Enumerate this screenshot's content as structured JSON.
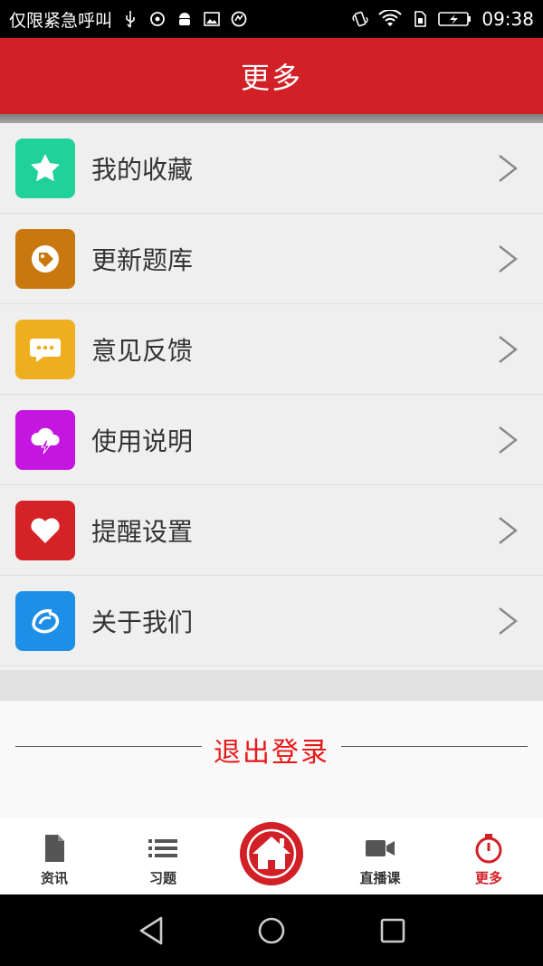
{
  "status_bar": {
    "carrier": "仅限紧急呼叫",
    "time": "09:38"
  },
  "header": {
    "title": "更多"
  },
  "menu": {
    "items": [
      {
        "label": "我的收藏",
        "icon": "star-icon",
        "color": "#20d19a"
      },
      {
        "label": "更新题库",
        "icon": "tag-icon",
        "color": "#c9780f"
      },
      {
        "label": "意见反馈",
        "icon": "chat-bubble-icon",
        "color": "#efae1e"
      },
      {
        "label": "使用说明",
        "icon": "cloud-bolt-icon",
        "color": "#c416e0"
      },
      {
        "label": "提醒设置",
        "icon": "heart-icon",
        "color": "#d52226"
      },
      {
        "label": "关于我们",
        "icon": "logo-swirl-icon",
        "color": "#1e8fe6"
      }
    ]
  },
  "logout": {
    "label": "退出登录",
    "color": "#e61919"
  },
  "tabs": [
    {
      "label": "资讯",
      "icon": "document-icon"
    },
    {
      "label": "习题",
      "icon": "list-icon"
    },
    {
      "label": "",
      "icon": "home-icon"
    },
    {
      "label": "直播课",
      "icon": "video-camera-icon"
    },
    {
      "label": "更多",
      "icon": "stopwatch-icon",
      "active": true
    }
  ],
  "colors": {
    "brand": "#d12026"
  }
}
